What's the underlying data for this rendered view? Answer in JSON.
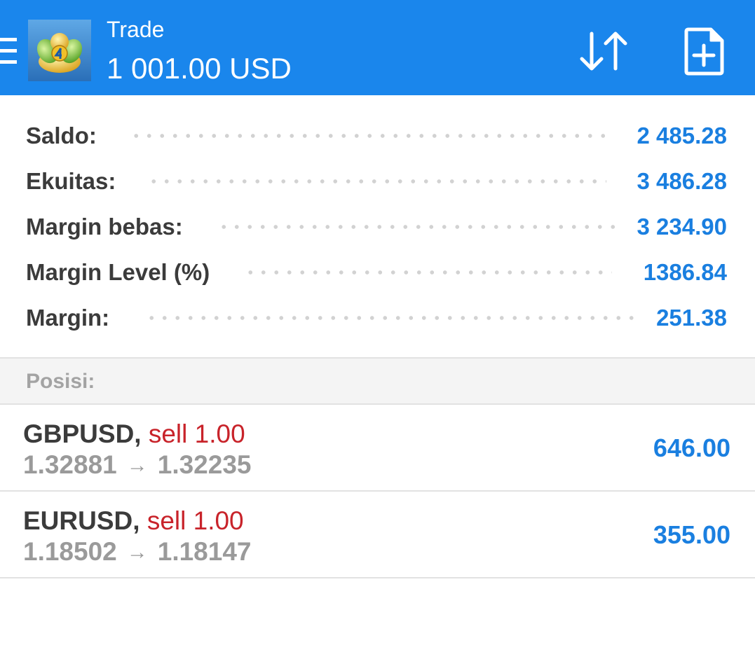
{
  "header": {
    "title": "Trade",
    "balance": "1 001.00 USD",
    "icons": {
      "menu": "hamburger-menu-icon",
      "logo": "metatrader-4-logo",
      "sort": "sort-arrows-icon",
      "new_order": "new-document-plus-icon"
    }
  },
  "summary": {
    "rows": [
      {
        "label": "Saldo:",
        "value": "2 485.28"
      },
      {
        "label": "Ekuitas:",
        "value": "3 486.28"
      },
      {
        "label": "Margin bebas:",
        "value": "3 234.90"
      },
      {
        "label": "Margin Level (%)",
        "value": "1386.84"
      },
      {
        "label": "Margin:",
        "value": "251.38"
      }
    ]
  },
  "positions": {
    "title": "Posisi:",
    "arrow": "→",
    "items": [
      {
        "symbol": "GBPUSD,",
        "type": "sell 1.00",
        "open_price": "1.32881",
        "current_price": "1.32235",
        "profit": "646.00"
      },
      {
        "symbol": "EURUSD,",
        "type": "sell 1.00",
        "open_price": "1.18502",
        "current_price": "1.18147",
        "profit": "355.00"
      }
    ]
  },
  "colors": {
    "header_bg": "#1a86ec",
    "value_blue": "#1a7fe0",
    "sell_red": "#c8232a",
    "label_dark": "#3b3b3b",
    "muted_gray": "#9a9a9a"
  }
}
